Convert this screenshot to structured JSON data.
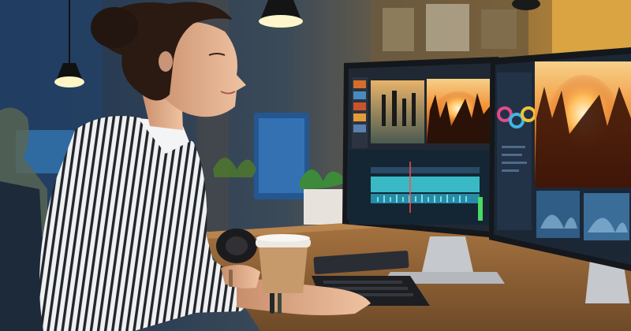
{
  "scene": {
    "subject": "woman-video-editor-at-dual-monitors",
    "palette": {
      "office_blue": "#24405e",
      "warm_wall": "#c8892f",
      "desk_wood": "#9a6a3a",
      "monitor_frame": "#1a1d22",
      "timeline_cyan": "#3fd3e0",
      "sunset_orange": "#f07a22",
      "shirt_stripe_dark": "#24262b",
      "shirt_stripe_light": "#e9ecef",
      "hair": "#2a1a12",
      "skin": "#e2b08f",
      "cup": "#c79a6b"
    }
  }
}
